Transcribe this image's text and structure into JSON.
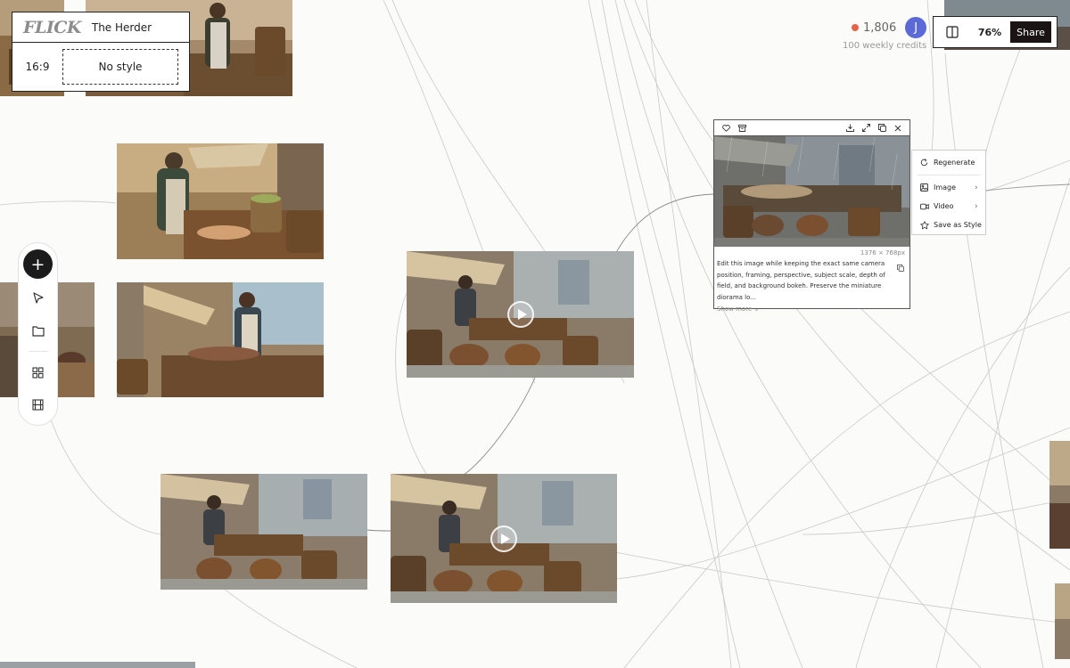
{
  "project": {
    "logo": "FLICK",
    "name": "The Herder",
    "aspect": "16:9",
    "style": "No style"
  },
  "header": {
    "credits": "1,806",
    "avatar_initial": "J",
    "weekly_credits": "100 weekly credits",
    "zoom": "76%",
    "share_label": "Share"
  },
  "selected": {
    "dimensions": "1376 × 768px",
    "prompt": "Edit this image while keeping the exact same camera position, framing, perspective, subject scale, depth of field, and background bokeh. Preserve the miniature diorama lo...",
    "show_more": "Show more ⌄"
  },
  "context_menu": {
    "regenerate": "Regenerate",
    "image": "Image",
    "video": "Video",
    "save_style": "Save as Style"
  },
  "colors": {
    "accent_dark": "#1a1414",
    "credit_dot": "#e8604c",
    "avatar": "#5b6ad6"
  }
}
